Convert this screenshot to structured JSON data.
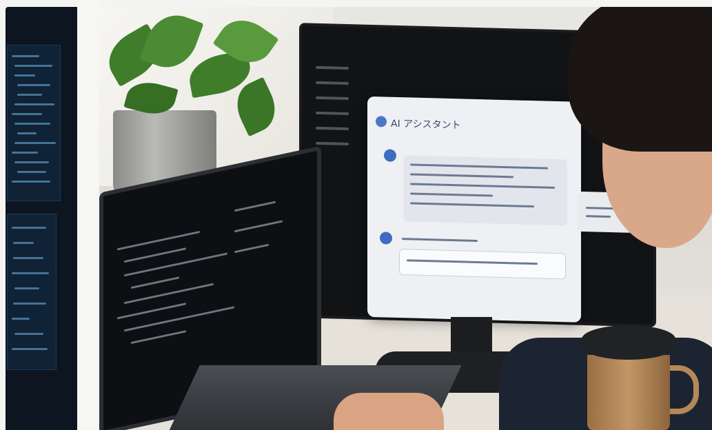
{
  "photo": {
    "dialog_title": "AI アシスタント"
  },
  "colors": {
    "left_panel_bg": "#0c1520",
    "dialog_bg": "#eef0f3",
    "accent_blue": "#3d6cc0"
  }
}
